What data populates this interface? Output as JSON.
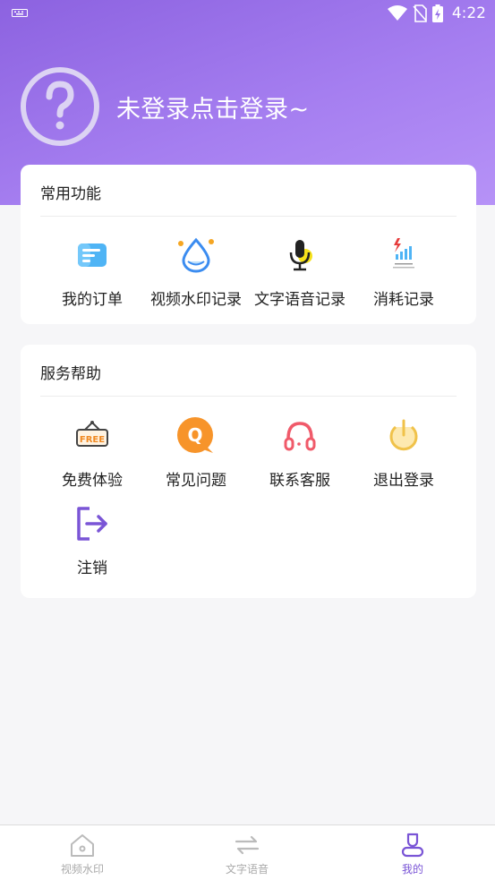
{
  "status_bar": {
    "time": "4:22"
  },
  "profile": {
    "login_prompt": "未登录点击登录~"
  },
  "common_functions": {
    "title": "常用功能",
    "items": [
      {
        "label": "我的订单",
        "icon": "order-icon"
      },
      {
        "label": "视频水印记录",
        "icon": "watermark-drop-icon"
      },
      {
        "label": "文字语音记录",
        "icon": "microphone-icon"
      },
      {
        "label": "消耗记录",
        "icon": "energy-consumption-icon"
      }
    ]
  },
  "service_help": {
    "title": "服务帮助",
    "items": [
      {
        "label": "免费体验",
        "icon": "free-sign-icon"
      },
      {
        "label": "常见问题",
        "icon": "faq-q-icon"
      },
      {
        "label": "联系客服",
        "icon": "headset-icon"
      },
      {
        "label": "退出登录",
        "icon": "power-icon"
      },
      {
        "label": "注销",
        "icon": "logout-arrow-icon"
      }
    ]
  },
  "bottom_nav": {
    "items": [
      {
        "label": "视频水印",
        "icon": "home-icon"
      },
      {
        "label": "文字语音",
        "icon": "swap-arrows-icon"
      },
      {
        "label": "我的",
        "icon": "profile-icon"
      }
    ],
    "active_index": 2
  },
  "colors": {
    "accent": "#7a55d6",
    "header_start": "#8c62e0",
    "header_end": "#b692f7"
  }
}
